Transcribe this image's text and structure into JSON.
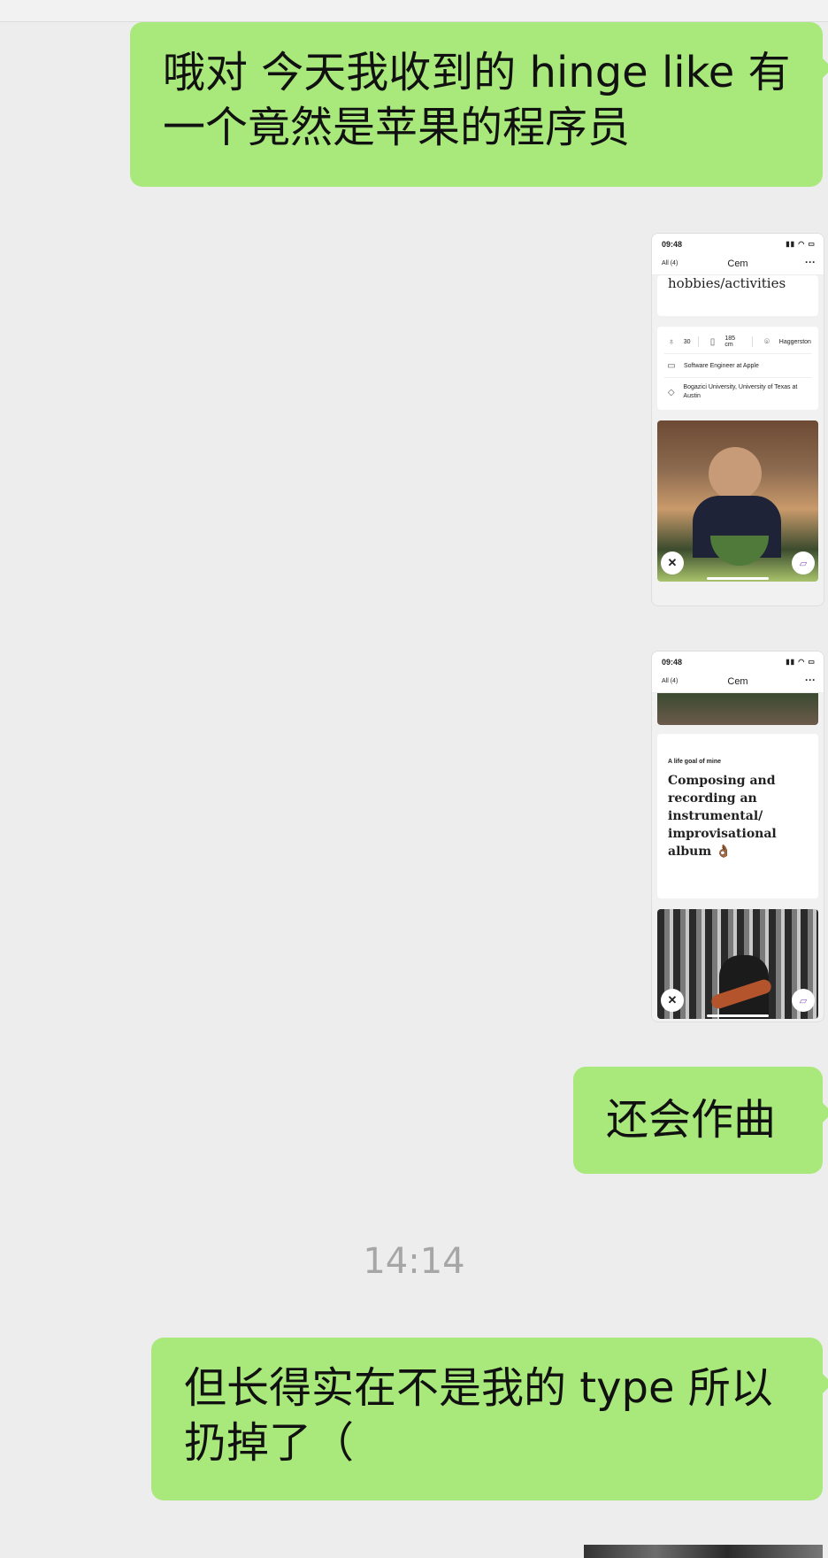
{
  "messages": [
    {
      "text": "哦对 今天我收到的 hinge like 有一个竟然是苹果的程序员"
    },
    {
      "text": "还会作曲"
    },
    {
      "text": "但长得实在不是我的 type 所以扔掉了（"
    }
  ],
  "timestamp": "14:14",
  "screenshot1": {
    "status_time": "09:48",
    "status_icons": "▮▮ ◠ ▭",
    "nav_all": "All (4)",
    "nav_name": "Cem",
    "nav_more": "···",
    "prompt_tail": "hobbies/activities",
    "vitals": {
      "age": "30",
      "height": "185 cm",
      "location": "Haggerston",
      "job": "Software Engineer at Apple",
      "education": "Bogazici University, University of Texas at Austin"
    },
    "icons": [
      "age-icon",
      "height-icon",
      "location-icon",
      "job-icon",
      "education-icon",
      "close-icon",
      "comment-icon"
    ]
  },
  "screenshot2": {
    "status_time": "09:48",
    "status_icons": "▮▮ ◠ ▭",
    "nav_all": "All (4)",
    "nav_name": "Cem",
    "nav_more": "···",
    "prompt_label": "A life goal of mine",
    "prompt_answer": "Composing and recording an instrumental/ improvisational album 👌🏾"
  }
}
